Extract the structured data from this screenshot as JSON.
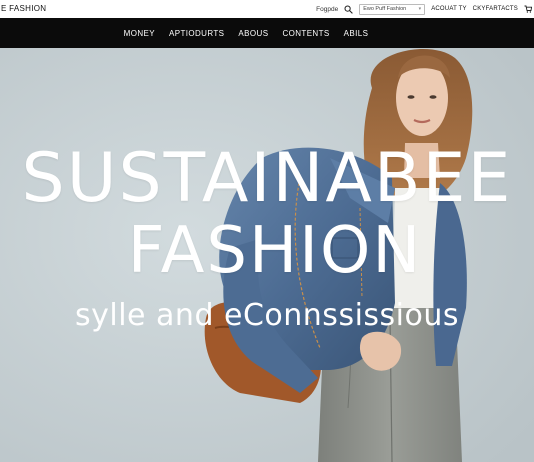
{
  "brand": {
    "logo_text": "E FASHION"
  },
  "topbar": {
    "search_label": "Fogpde",
    "search_placeholder": "Ewo Puff Fashion",
    "account_label": "ACOUAT TY",
    "contacts_label": "CKYFARTACTS"
  },
  "nav": {
    "items": [
      {
        "label": "MONEY"
      },
      {
        "label": "APTIODURTS"
      },
      {
        "label": "ABOUS"
      },
      {
        "label": "CONTENTS"
      },
      {
        "label": "ABILS"
      }
    ]
  },
  "hero": {
    "title_line1": "SUSTAINABEE",
    "title_line2": "FASHION",
    "subtitle": "sylle and eConnssissious"
  },
  "colors": {
    "navbar_bg": "#0b0b0b",
    "hero_bg": "#c9d3d6",
    "text_white": "#ffffff",
    "jacket_blue": "#4f6e94",
    "pants_gray": "#8e918c",
    "bag_brown": "#a1582a"
  },
  "icons": {
    "search": "search-icon",
    "cart": "cart-icon"
  }
}
